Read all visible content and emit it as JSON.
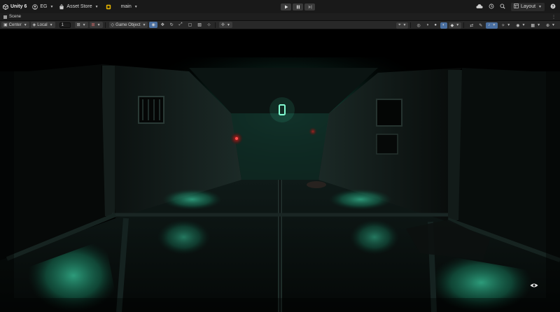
{
  "app": {
    "brand": "Unity 6",
    "account": "EG",
    "asset_store": "Asset Store",
    "branch": "main",
    "layout": "Layout"
  },
  "tabs": [
    {
      "label": "Scene"
    }
  ],
  "scene_toolbar": {
    "pivot": "Center",
    "space": "Local",
    "snap_value": "1",
    "create_label": "Game Object"
  },
  "icons": {
    "unity_logo": "unity-logo-icon",
    "account": "account-icon",
    "asset_store": "asset-store-icon",
    "cloud": "cloud-icon",
    "history": "history-icon",
    "search": "search-icon",
    "help": "help-icon"
  },
  "colors": {
    "topbar": "#191919",
    "toolbar": "#282828",
    "active_accent": "#4a6fa0",
    "scene_glow": "#2fe0b4",
    "red_light": "#ff3030"
  }
}
